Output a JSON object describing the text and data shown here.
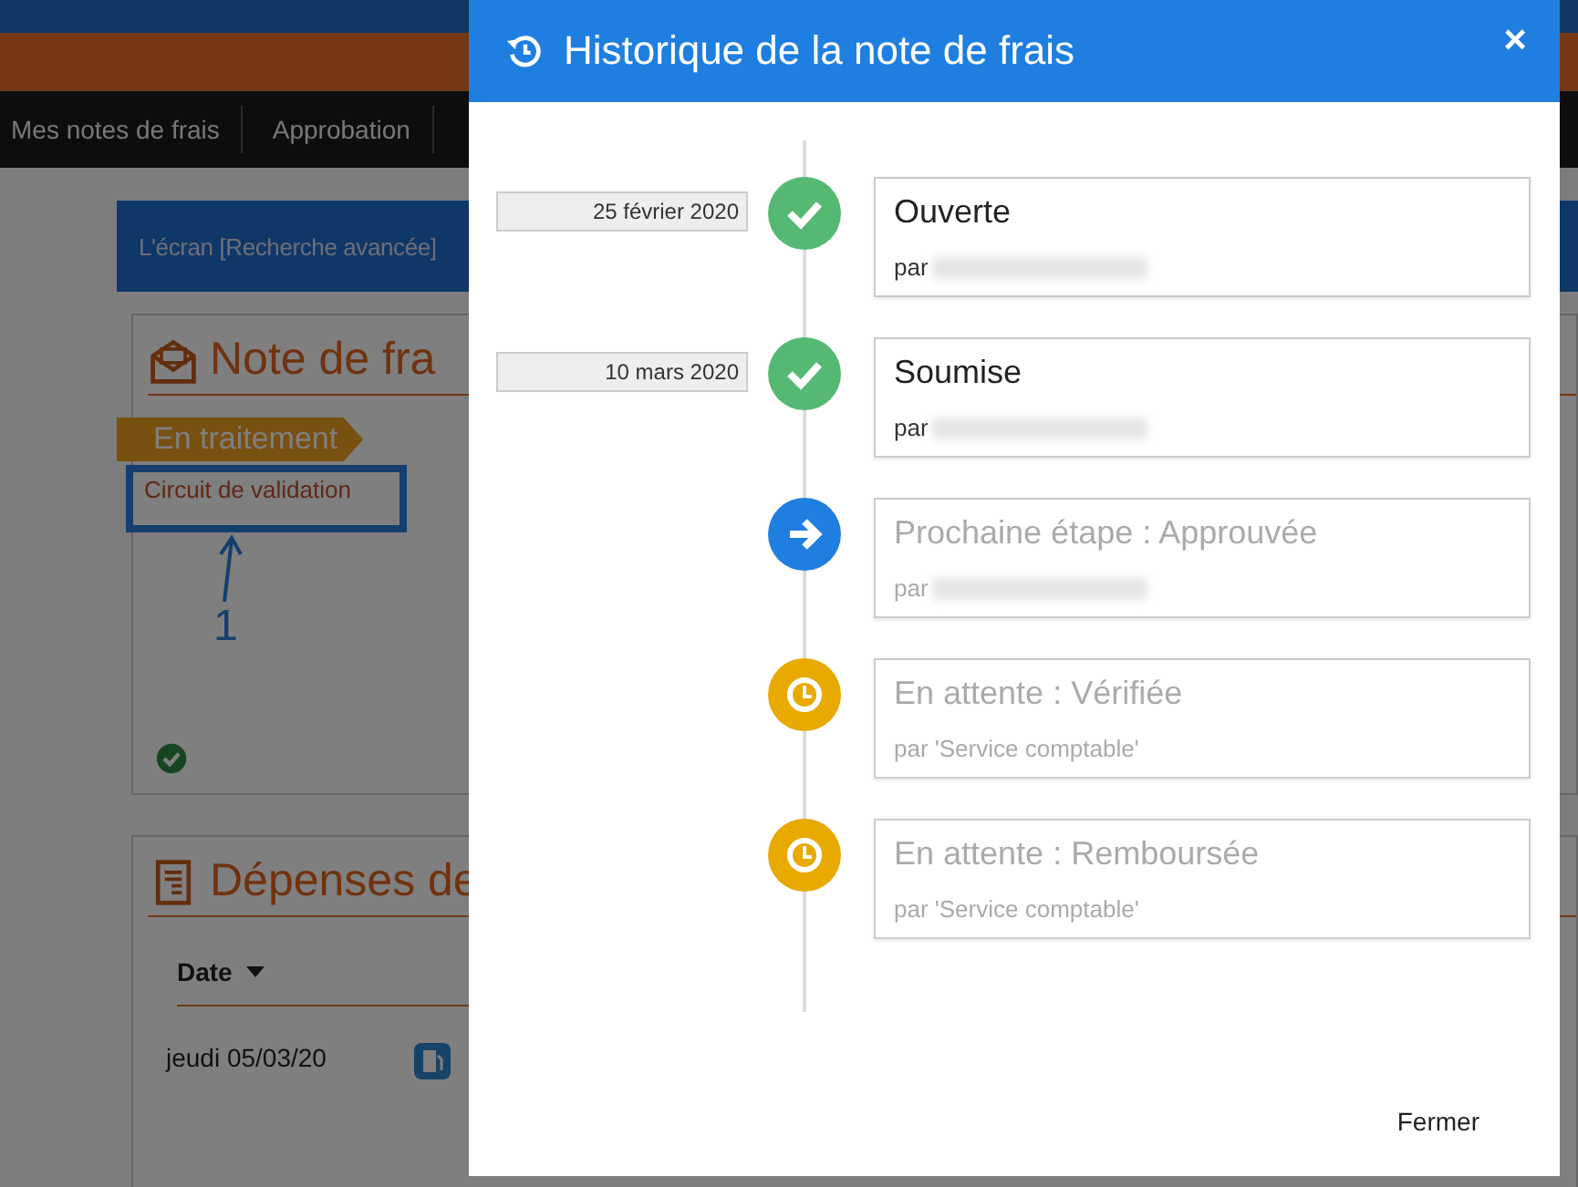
{
  "app_nav": {
    "items": [
      "Mes notes de frais",
      "Approbation"
    ]
  },
  "banner": {
    "text": "L'écran [Recherche avancée]"
  },
  "note_panel": {
    "title": "Note de fra",
    "status": "En traitement",
    "link": "Circuit de validation",
    "annotation": "1"
  },
  "expenses_panel": {
    "title": "Dépenses de",
    "column": "Date",
    "rows": [
      {
        "date": "jeudi 05/03/20"
      }
    ]
  },
  "modal": {
    "title": "Historique de la note de frais",
    "close": "×",
    "steps": [
      {
        "kind": "done",
        "date": "25 février 2020",
        "title": "Ouverte",
        "by": "par",
        "redacted": true
      },
      {
        "kind": "done",
        "date": "10 mars 2020",
        "title": "Soumise",
        "by": "par",
        "redacted": true
      },
      {
        "kind": "next",
        "title": "Prochaine étape : Approuvée",
        "by": "par",
        "redacted": true
      },
      {
        "kind": "pending",
        "title": "En attente : Vérifiée",
        "by": "par 'Service comptable'",
        "redacted": false
      },
      {
        "kind": "pending",
        "title": "En attente : Remboursée",
        "by": "par 'Service comptable'",
        "redacted": false
      }
    ],
    "footer_button": "Fermer"
  }
}
